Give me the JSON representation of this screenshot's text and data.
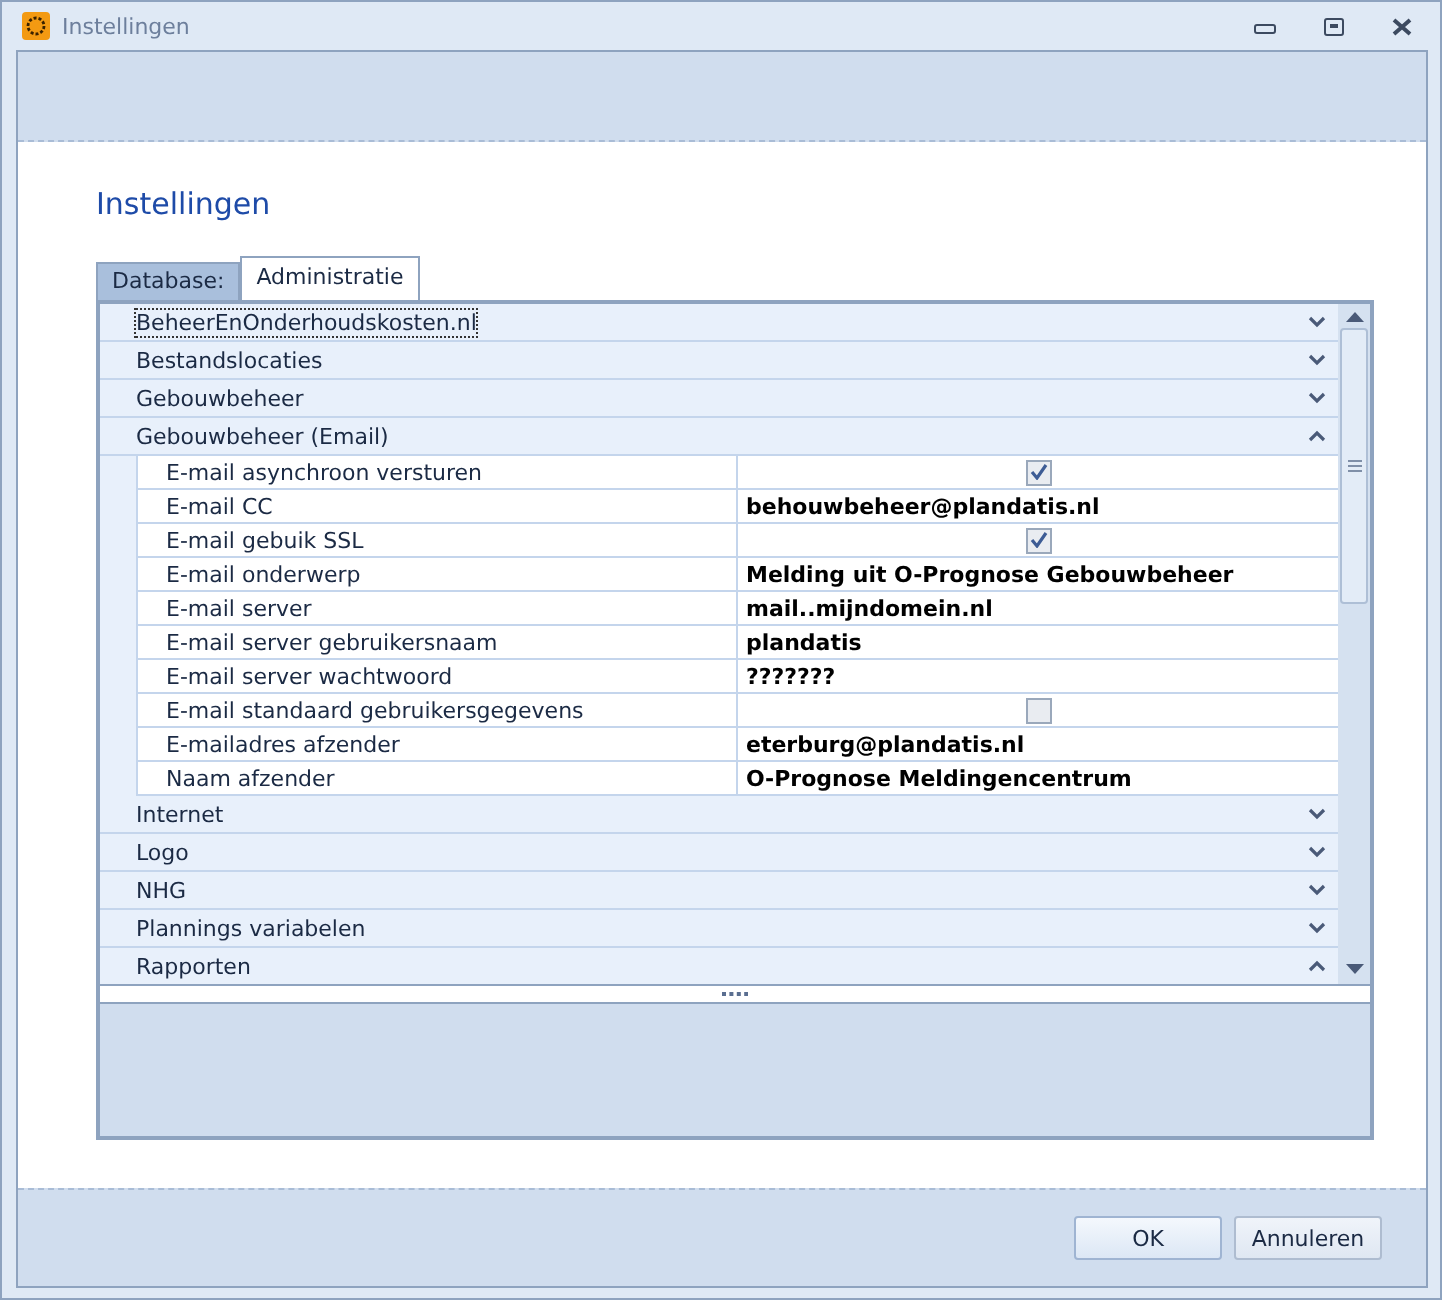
{
  "window": {
    "title": "Instellingen"
  },
  "heading": "Instellingen",
  "tabs": [
    {
      "label": "Database:",
      "selected": false
    },
    {
      "label": "Administratie",
      "selected": true
    }
  ],
  "categories": [
    {
      "label": "BeheerEnOnderhoudskosten.nl",
      "expanded": false,
      "focused": true
    },
    {
      "label": "Bestandslocaties",
      "expanded": false,
      "focused": false
    },
    {
      "label": "Gebouwbeheer",
      "expanded": false,
      "focused": false
    },
    {
      "label": "Gebouwbeheer (Email)",
      "expanded": true,
      "focused": false,
      "properties": [
        {
          "name": "E-mail asynchroon versturen",
          "kind": "checkbox",
          "checked": true
        },
        {
          "name": "E-mail CC",
          "kind": "text",
          "value": "behouwbeheer@plandatis.nl"
        },
        {
          "name": "E-mail gebuik SSL",
          "kind": "checkbox",
          "checked": true
        },
        {
          "name": "E-mail onderwerp",
          "kind": "text",
          "value": "Melding uit O-Prognose Gebouwbeheer"
        },
        {
          "name": "E-mail server",
          "kind": "text",
          "value": "mail..mijndomein.nl"
        },
        {
          "name": "E-mail server gebruikersnaam",
          "kind": "text",
          "value": "plandatis"
        },
        {
          "name": "E-mail server wachtwoord",
          "kind": "text",
          "value": "???????"
        },
        {
          "name": "E-mail standaard gebruikersgegevens",
          "kind": "checkbox",
          "checked": false
        },
        {
          "name": "E-mailadres afzender",
          "kind": "text",
          "value": "eterburg@plandatis.nl"
        },
        {
          "name": "Naam afzender",
          "kind": "text",
          "value": "O-Prognose Meldingencentrum"
        }
      ]
    },
    {
      "label": "Internet",
      "expanded": false,
      "focused": false
    },
    {
      "label": "Logo",
      "expanded": false,
      "focused": false
    },
    {
      "label": "NHG",
      "expanded": false,
      "focused": false
    },
    {
      "label": "Plannings variabelen",
      "expanded": false,
      "focused": false
    },
    {
      "label": "Rapporten",
      "expanded": true,
      "focused": false
    }
  ],
  "buttons": [
    {
      "label": "OK",
      "kind": "default"
    },
    {
      "label": "Annuleren",
      "kind": "normal"
    }
  ]
}
